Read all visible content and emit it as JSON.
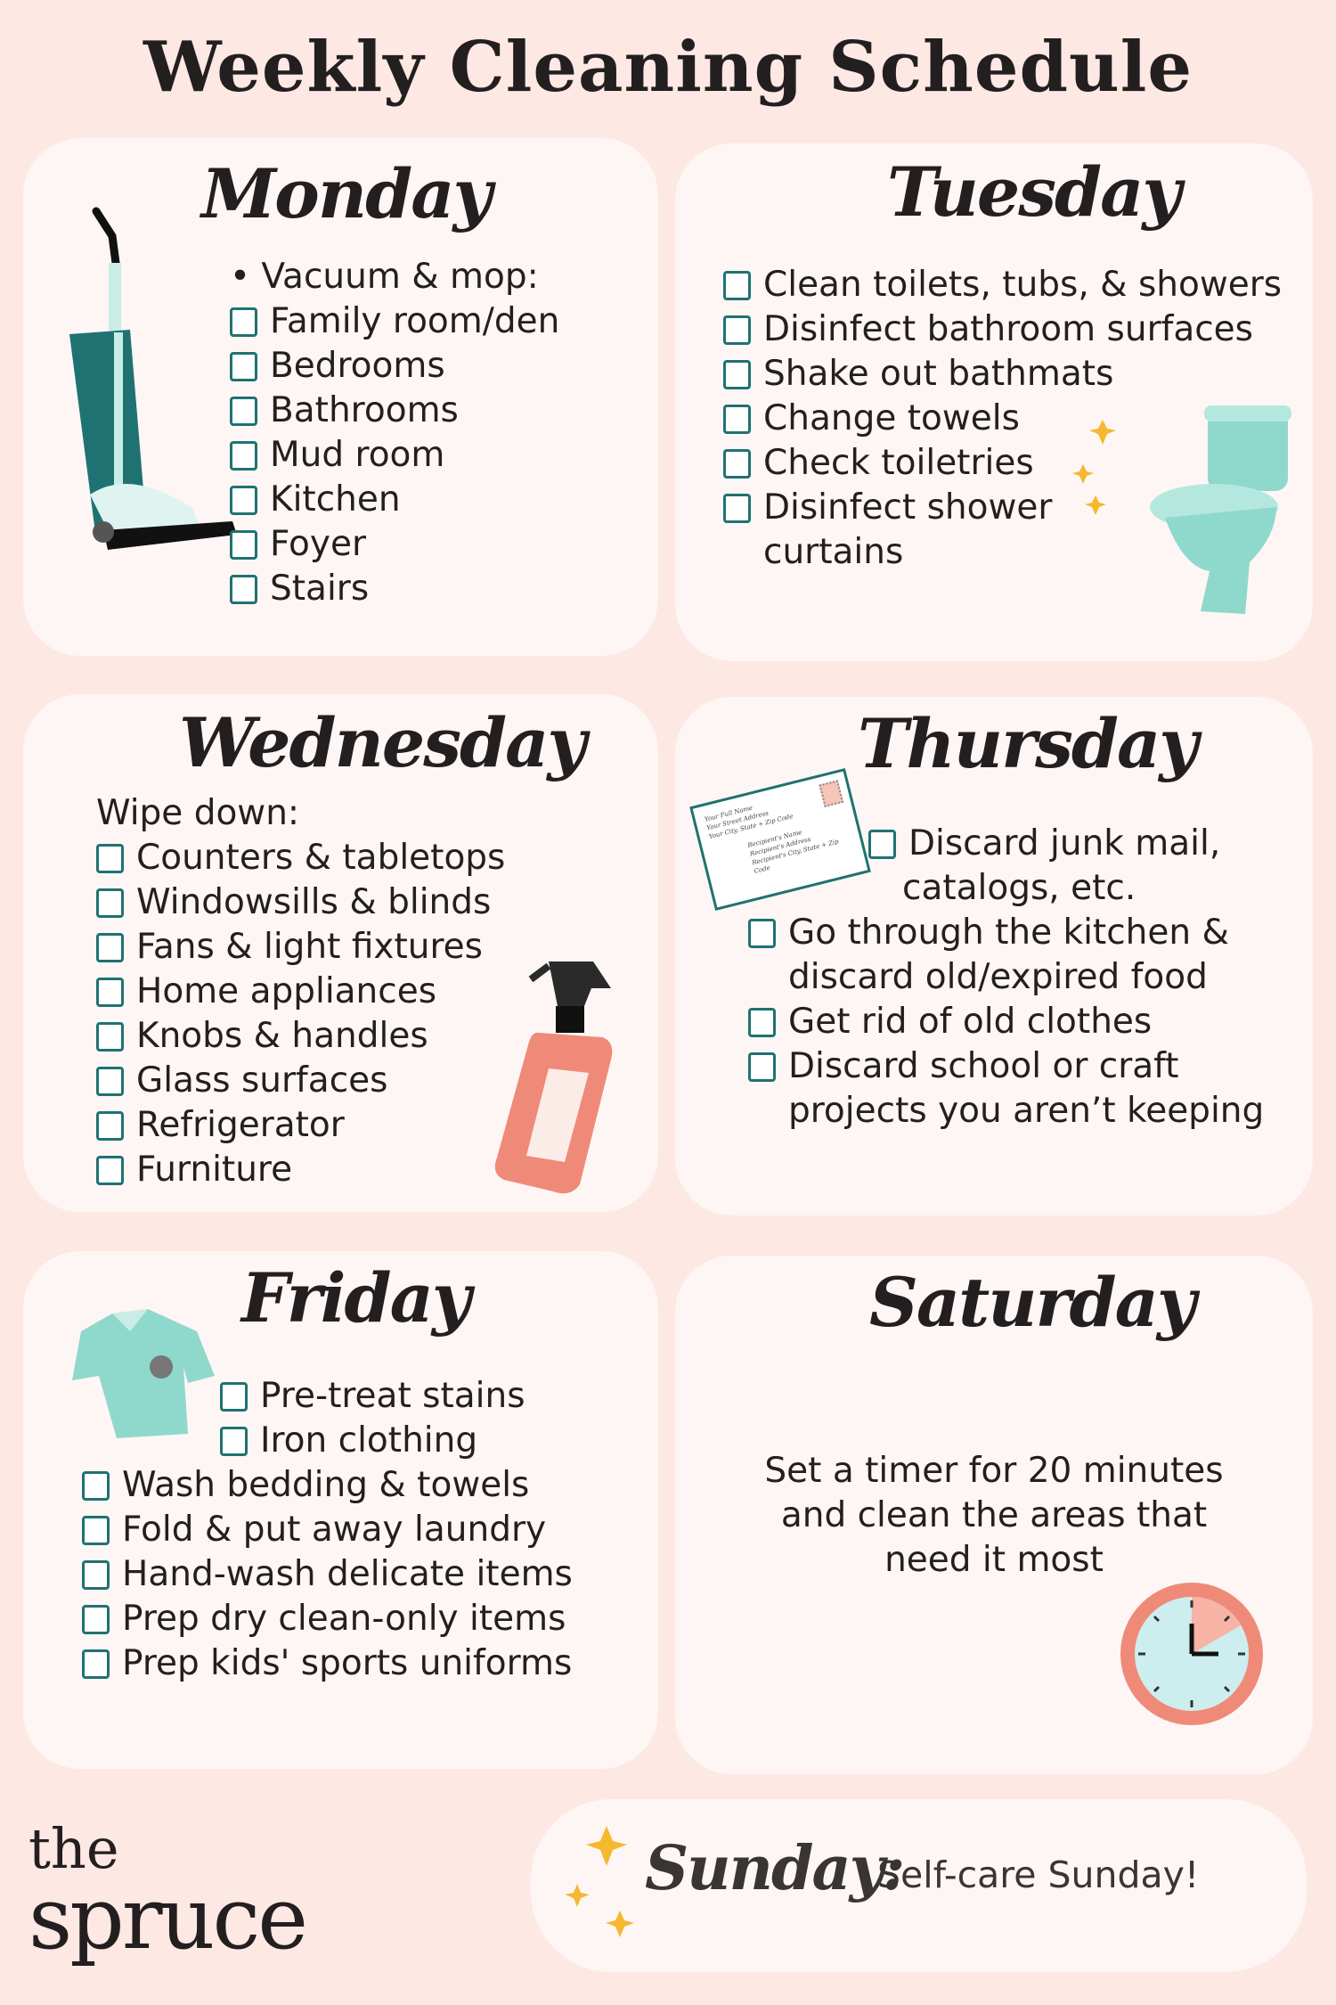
{
  "title": "Weekly Cleaning Schedule",
  "colors": {
    "background": "#fde8e4",
    "card": "#fdf6f4",
    "checkbox": "#1f7272",
    "text": "#231f20",
    "accent_coral": "#f08a78",
    "accent_mint": "#8fd8cc",
    "star": "#f5b82e"
  },
  "monday": {
    "heading": "Monday",
    "bullet": "Vacuum & mop:",
    "items": [
      "Family room/den",
      "Bedrooms",
      "Bathrooms",
      "Mud room",
      "Kitchen",
      "Foyer",
      "Stairs"
    ],
    "illustration": "vacuum-icon"
  },
  "tuesday": {
    "heading": "Tuesday",
    "items": [
      "Clean toilets, tubs, & showers",
      "Disinfect bathroom surfaces",
      "Shake out bathmats",
      "Change towels",
      "Check toiletries",
      "Disinfect shower"
    ],
    "item6_cont": "curtains",
    "illustration": "toilet-icon"
  },
  "wednesday": {
    "heading": "Wednesday",
    "bullet": "Wipe down:",
    "items": [
      "Counters & tabletops",
      "Windowsills & blinds",
      "Fans & light fixtures",
      "Home appliances",
      "Knobs & handles",
      "Glass surfaces",
      "Refrigerator",
      "Furniture"
    ],
    "illustration": "spray-bottle-icon"
  },
  "thursday": {
    "heading": "Thursday",
    "items": [
      {
        "line1": "Discard junk mail,",
        "line2": "catalogs, etc."
      },
      {
        "line1": "Go through the kitchen &",
        "line2": "discard old/expired food"
      },
      {
        "line1": "Get rid of old clothes"
      },
      {
        "line1": "Discard school or craft",
        "line2": "projects you aren’t keeping"
      }
    ],
    "envelope": {
      "sender": [
        "Your Full Name",
        "Your Street Address",
        "Your City, State + Zip Code"
      ],
      "recipient": [
        "Recipient's Name",
        "Recipient's Address",
        "Recipient's City, State + Zip Code"
      ]
    }
  },
  "friday": {
    "heading": "Friday",
    "items": [
      "Pre-treat stains",
      "Iron clothing",
      "Wash bedding & towels",
      "Fold & put away laundry",
      "Hand-wash delicate items",
      "Prep dry clean-only items",
      "Prep kids' sports uniforms"
    ],
    "illustration": "shirt-icon"
  },
  "saturday": {
    "heading": "Saturday",
    "text": [
      "Set a timer for 20 minutes",
      "and clean the areas that",
      "need it most"
    ],
    "illustration": "timer-clock-icon",
    "timer_minutes": 20
  },
  "sunday": {
    "heading": "Sunday:",
    "text": "Self-care Sunday!"
  },
  "logo": {
    "line1": "the",
    "line2": "spruce"
  }
}
